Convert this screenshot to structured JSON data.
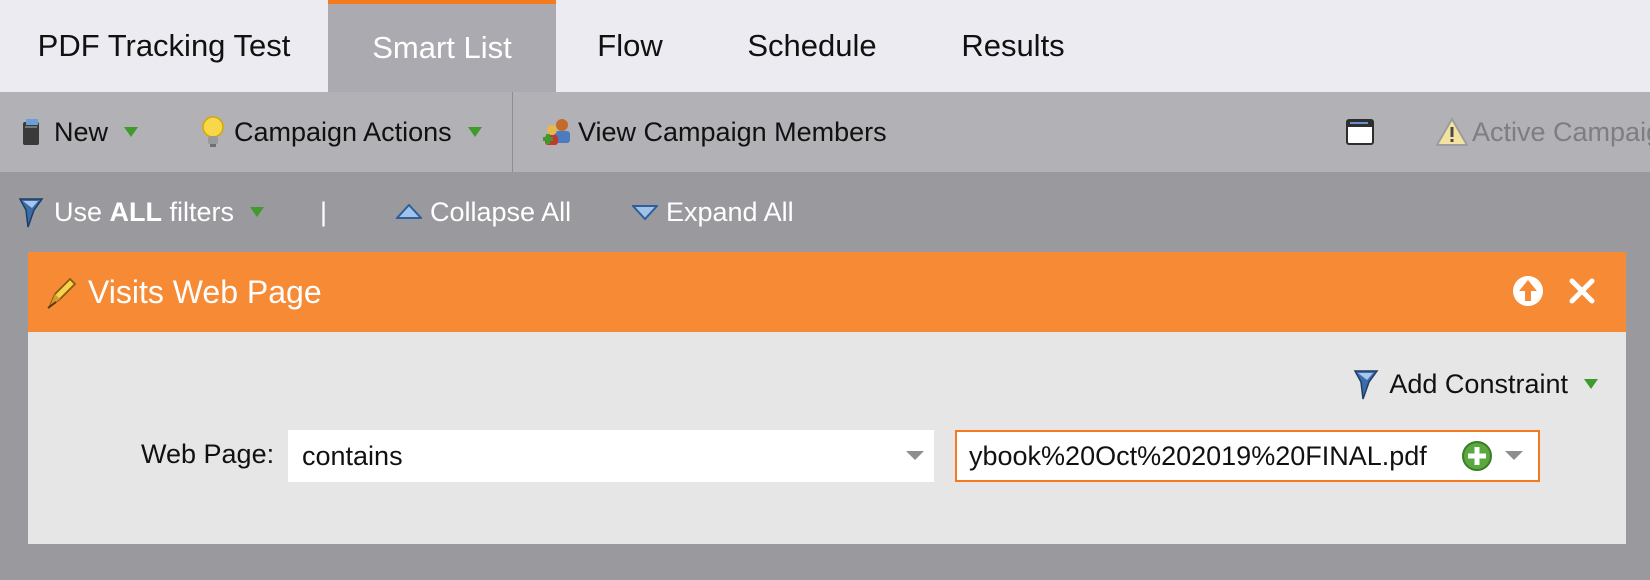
{
  "tabs": [
    {
      "label": "PDF Tracking Test",
      "active": false
    },
    {
      "label": "Smart List",
      "active": true
    },
    {
      "label": "Flow",
      "active": false
    },
    {
      "label": "Schedule",
      "active": false
    },
    {
      "label": "Results",
      "active": false
    }
  ],
  "toolbar": {
    "new_label": "New",
    "campaign_actions_label": "Campaign Actions",
    "view_members_label": "View Campaign Members",
    "status_label": "Active Campaig"
  },
  "filterbar": {
    "use_prefix": "Use ",
    "use_bold": "ALL",
    "use_suffix": " filters",
    "separator": "|",
    "collapse_label": "Collapse All",
    "expand_label": "Expand All"
  },
  "filter": {
    "title": "Visits Web Page",
    "add_constraint_label": "Add Constraint",
    "field_label": "Web Page:",
    "operator_value": "contains",
    "value_text": "ybook%20Oct%202019%20FINAL.pdf"
  },
  "colors": {
    "accent_orange": "#f78a35",
    "active_tab_border": "#f47a1f",
    "green": "#3f9b2c"
  }
}
